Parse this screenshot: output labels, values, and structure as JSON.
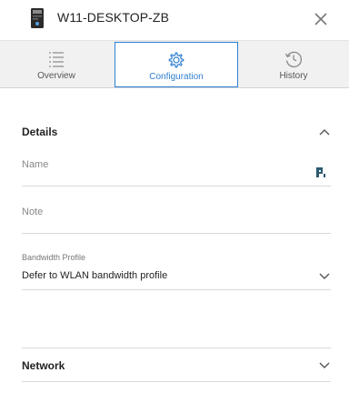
{
  "header": {
    "title": "W11-DESKTOP-ZB",
    "device_icon": "desktop-tower-icon",
    "close_icon": "close-icon"
  },
  "tabs": [
    {
      "label": "Overview",
      "icon": "list-icon",
      "active": false
    },
    {
      "label": "Configuration",
      "icon": "gear-icon",
      "active": true
    },
    {
      "label": "History",
      "icon": "history-clock-icon",
      "active": false
    }
  ],
  "details": {
    "title": "Details",
    "expanded": true,
    "name": {
      "label": "Name",
      "value": "",
      "icon": "password-manager-icon"
    },
    "note": {
      "label": "Note",
      "value": ""
    },
    "bandwidth": {
      "label": "Bandwidth Profile",
      "value": "Defer to WLAN bandwidth profile"
    }
  },
  "network": {
    "title": "Network",
    "expanded": false
  },
  "colors": {
    "accent": "#2f7fd0",
    "tabbar_bg": "#f1f1f1",
    "divider": "#d9d9d9",
    "text": "#222222",
    "muted": "#888888",
    "pw_icon": "#2a5a70"
  }
}
